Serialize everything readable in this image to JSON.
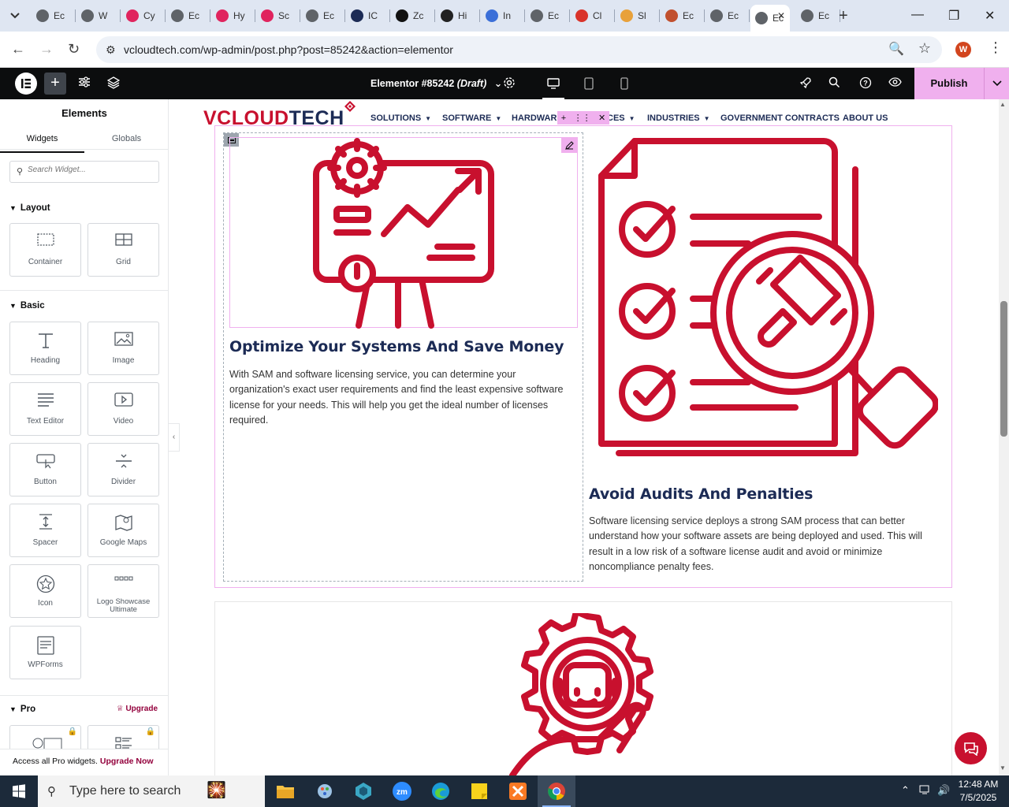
{
  "browser": {
    "tabs": [
      {
        "label": "Ec",
        "color": "#5f6368"
      },
      {
        "label": "W",
        "color": "#5f6368"
      },
      {
        "label": "Cy",
        "color": "#e0245e"
      },
      {
        "label": "Ec",
        "color": "#5f6368"
      },
      {
        "label": "Hy",
        "color": "#e0245e"
      },
      {
        "label": "Sc",
        "color": "#e0245e"
      },
      {
        "label": "Ec",
        "color": "#5f6368"
      },
      {
        "label": "IC",
        "color": "#1c2b55"
      },
      {
        "label": "Zc",
        "color": "#111111"
      },
      {
        "label": "Hi",
        "color": "#222222"
      },
      {
        "label": "In",
        "color": "#3b6fd8"
      },
      {
        "label": "Ec",
        "color": "#5f6368"
      },
      {
        "label": "Cl",
        "color": "#d9332a"
      },
      {
        "label": "Sl",
        "color": "#e8a13a"
      },
      {
        "label": "Ec",
        "color": "#c1502e"
      },
      {
        "label": "Ec",
        "color": "#5f6368"
      },
      {
        "label": "Ec",
        "color": "#5f6368",
        "active": true
      },
      {
        "label": "Ec",
        "color": "#5f6368"
      }
    ],
    "url": "vcloudtech.com/wp-admin/post.php?post=85242&action=elementor",
    "profile_initial": "W"
  },
  "editor": {
    "document_title": "Elementor #85242",
    "document_status": "(Draft)",
    "publish_label": "Publish"
  },
  "panel": {
    "title": "Elements",
    "tabs": [
      "Widgets",
      "Globals"
    ],
    "search_placeholder": "Search Widget...",
    "layout_label": "Layout",
    "basic_label": "Basic",
    "pro_label": "Pro",
    "upgrade_label": "Upgrade",
    "layout_widgets": [
      "Container",
      "Grid"
    ],
    "basic_widgets": [
      "Heading",
      "Image",
      "Text Editor",
      "Video",
      "Button",
      "Divider",
      "Spacer",
      "Google Maps",
      "Icon",
      "Logo Showcase Ultimate",
      "WPForms"
    ],
    "footer_text": "Access all Pro widgets.",
    "footer_link": "Upgrade Now"
  },
  "site": {
    "logo_left": "VCLOUD",
    "logo_right": "TECH",
    "nav": [
      {
        "label": "SOLUTIONS",
        "dropdown": true
      },
      {
        "label": "SOFTWARE",
        "dropdown": true
      },
      {
        "label": "HARDWARE",
        "dropdown": false
      },
      {
        "label": "CES",
        "dropdown": true
      },
      {
        "label": "INDUSTRIES",
        "dropdown": true
      },
      {
        "label": "GOVERNMENT CONTRACTS",
        "dropdown": false
      },
      {
        "label": "ABOUT US",
        "dropdown": false
      }
    ],
    "features": [
      {
        "title": "Optimize Your Systems And Save Money",
        "text": "With SAM and software licensing service, you can determine your organization's exact user requirements and find the least expensive software license for your needs. This will help you get the ideal number of licenses required."
      },
      {
        "title": "Avoid Audits And Penalties",
        "text": "Software licensing service deploys a strong SAM process that can better understand how your software assets are being deployed and used. This will result in a low risk of a software license audit and avoid or minimize noncompliance penalty fees."
      }
    ],
    "brand_red": "#c8102e",
    "brand_navy": "#1c2b55"
  },
  "taskbar": {
    "search_text": "Type here to search",
    "time": "12:48 AM",
    "date": "7/5/2025"
  }
}
